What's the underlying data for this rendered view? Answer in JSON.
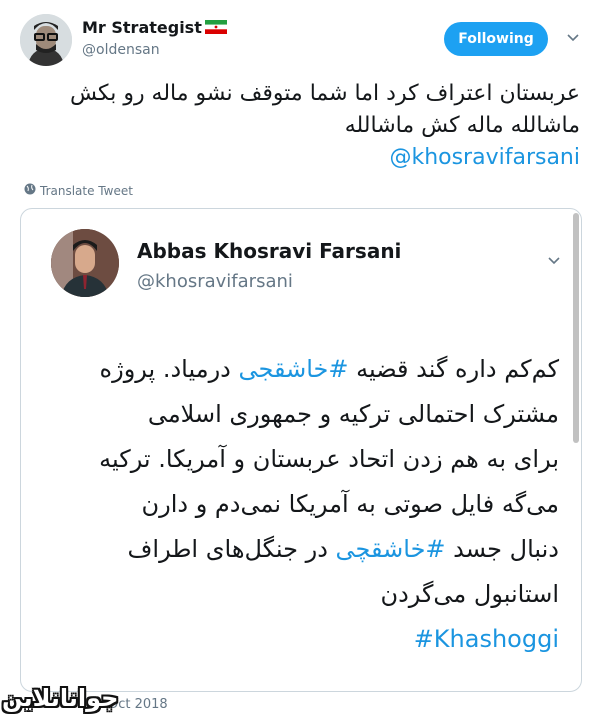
{
  "header": {
    "display_name": "Mr Strategist",
    "handle": "@oldensan",
    "follow_label": "Following"
  },
  "tweet": {
    "lines": [
      "عربستان اعتراف کرد اما شما متوقف نشو ماله رو بکش",
      "ماشالله ماله کش ماشالله"
    ],
    "mention": "@khosravifarsani",
    "translate_label": "Translate Tweet"
  },
  "quoted": {
    "display_name": "Abbas Khosravi Farsani",
    "handle": "@khosravifarsani",
    "line1_before": "کم‌کم داره گند قضیه ",
    "hashtag1": "#خاشقجی",
    "line1_after": " درمیاد. پروژه",
    "line2": "مشترک احتمالی ترکیه و جمهوری اسلامی",
    "line3": "برای به هم زدن اتحاد عربستان و آمریکا. ترکیه",
    "line4": "می‌گه فایل صوتی به آمریکا نمی‌دم و دارن",
    "line5_before": "دنبال جسد ",
    "hashtag2": "#خاشقچی",
    "line5_after": " در جنگل‌های اطراف",
    "line6": "استانبول می‌گردن",
    "hashtag3": "#Khashoggi"
  },
  "footer": {
    "date": "Oct 2018",
    "watermark": "جوانانلاین"
  },
  "colors": {
    "accent": "#1da1f2",
    "link": "#1b95e0",
    "muted": "#657786",
    "border": "#ccd6dd"
  },
  "icons": [
    "avatar",
    "iran-flag-icon",
    "chevron-down-icon",
    "globe-icon"
  ]
}
